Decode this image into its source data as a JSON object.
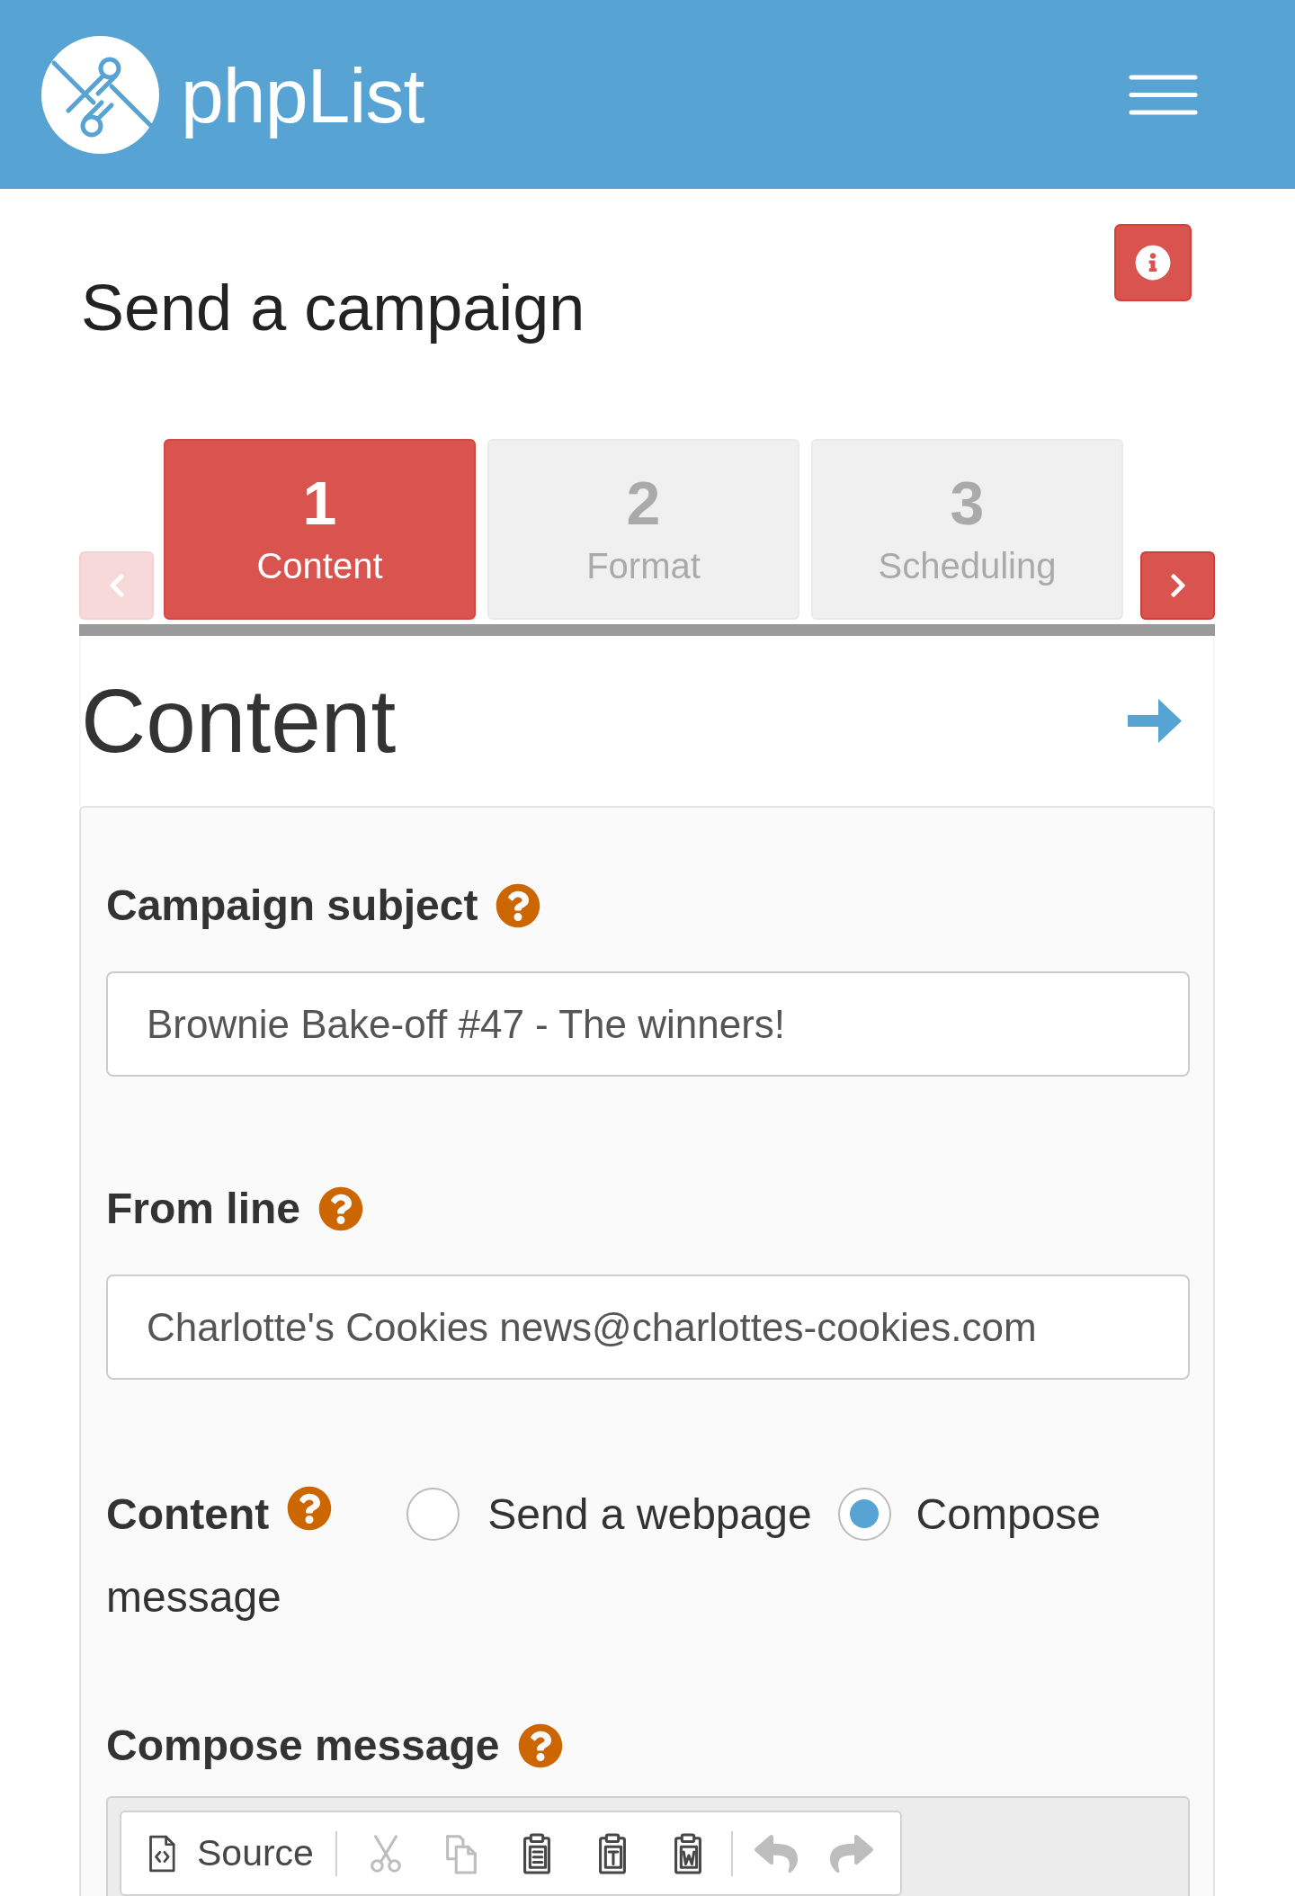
{
  "header": {
    "brand": "phpList"
  },
  "page": {
    "title": "Send a campaign"
  },
  "steps": {
    "prev": {
      "disabled": true
    },
    "next": {
      "disabled": false
    },
    "tabs": [
      {
        "number": "1",
        "label": "Content",
        "selected": true
      },
      {
        "number": "2",
        "label": "Format",
        "selected": false
      },
      {
        "number": "3",
        "label": "Scheduling",
        "selected": false
      }
    ]
  },
  "section": {
    "title": "Content"
  },
  "form": {
    "fields": [
      {
        "kind": "text",
        "label": "Campaign subject",
        "value": "Brownie Bake-off #47 - The winners!"
      },
      {
        "kind": "text",
        "label": "From line",
        "value": "Charlotte's Cookies news@charlottes-cookies.com"
      },
      {
        "kind": "radio",
        "label": "Content",
        "options": [
          {
            "label": "Send a webpage",
            "selected": false
          },
          {
            "label": "Compose message",
            "selected": true
          }
        ]
      },
      {
        "kind": "editor",
        "label": "Compose message",
        "toolbar": [
          {
            "items": [
              {
                "kind": "source",
                "label": "Source",
                "disabled": false
              }
            ]
          },
          {
            "items": [
              {
                "kind": "cut",
                "disabled": true
              },
              {
                "kind": "copy",
                "disabled": true
              },
              {
                "kind": "paste",
                "disabled": false
              },
              {
                "kind": "pastetext",
                "disabled": false
              },
              {
                "kind": "pasteword",
                "disabled": false
              }
            ]
          },
          {
            "items": [
              {
                "kind": "undo",
                "disabled": true
              },
              {
                "kind": "redo",
                "disabled": true
              }
            ]
          }
        ]
      }
    ]
  }
}
